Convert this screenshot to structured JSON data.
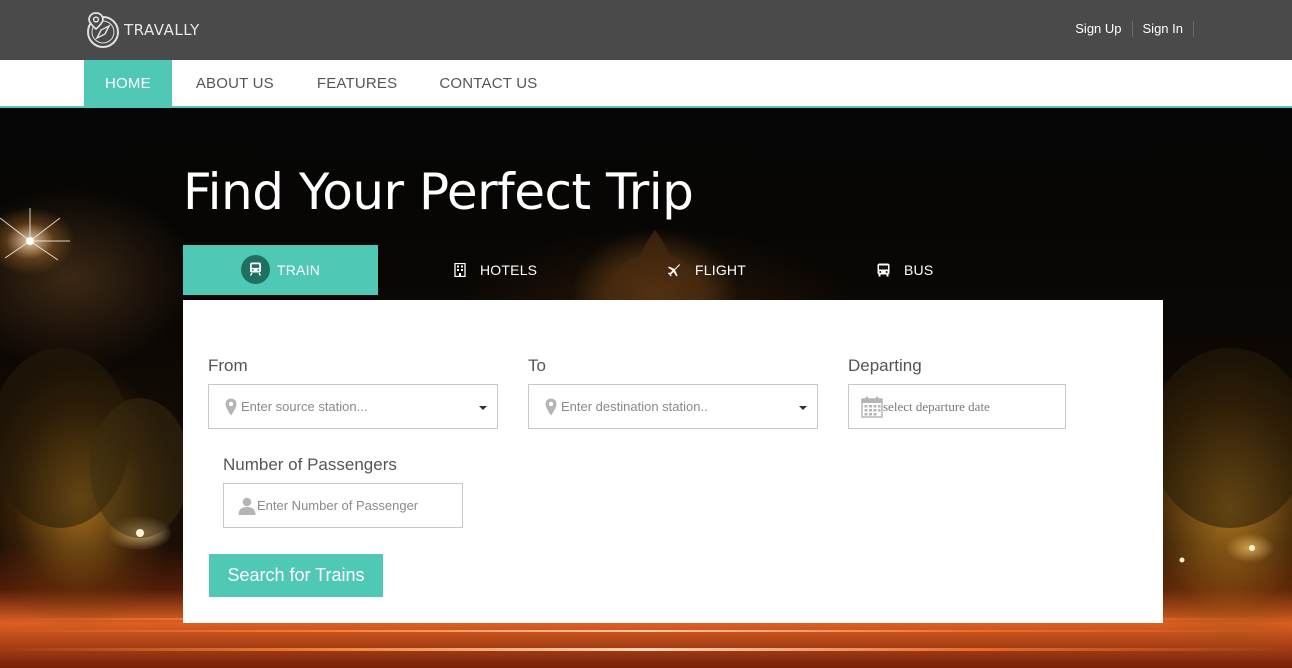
{
  "brand": {
    "name": "TRAVALLY"
  },
  "auth": {
    "sign_up": "Sign Up",
    "sign_in": "Sign In"
  },
  "nav": {
    "items": [
      {
        "label": "HOME",
        "active": true
      },
      {
        "label": "ABOUT US",
        "active": false
      },
      {
        "label": "FEATURES",
        "active": false
      },
      {
        "label": "CONTACT US",
        "active": false
      }
    ]
  },
  "hero": {
    "title": "Find Your Perfect Trip"
  },
  "tabs": [
    {
      "label": "TRAIN",
      "icon": "train-icon",
      "active": true
    },
    {
      "label": "HOTELS",
      "icon": "building-icon",
      "active": false
    },
    {
      "label": "FLIGHT",
      "icon": "plane-icon",
      "active": false
    },
    {
      "label": "BUS",
      "icon": "bus-icon",
      "active": false
    }
  ],
  "form": {
    "from": {
      "label": "From",
      "placeholder": "Enter source station...",
      "value": ""
    },
    "to": {
      "label": "To",
      "placeholder": "Enter destination station..",
      "value": ""
    },
    "departing": {
      "label": "Departing",
      "placeholder": "select departure date",
      "value": ""
    },
    "passengers": {
      "label": "Number of Passengers",
      "placeholder": "Enter Number of Passenger",
      "value": ""
    },
    "submit_label": "Search for Trains"
  },
  "colors": {
    "accent": "#4fc9b6",
    "topbar": "#4a4a4a",
    "nav_bg": "#ffffff"
  }
}
